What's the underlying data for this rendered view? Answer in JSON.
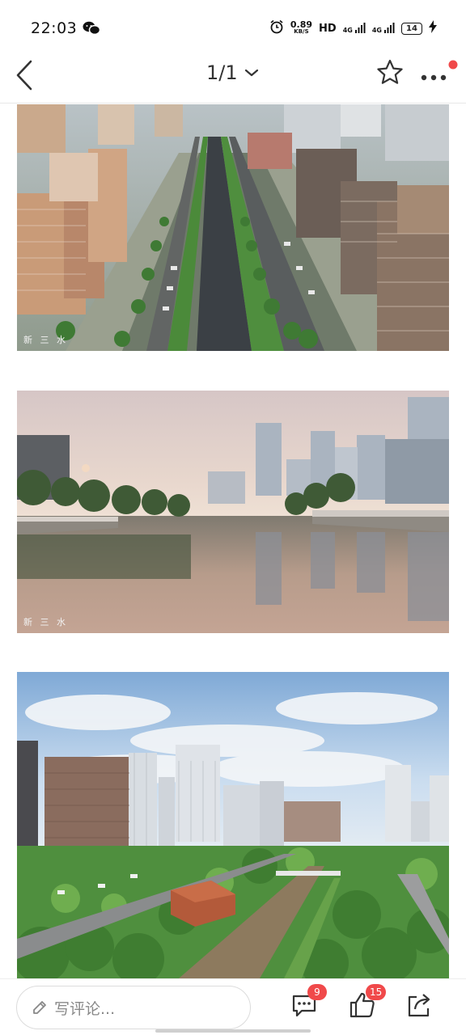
{
  "status_bar": {
    "time": "22:03",
    "net_speed_value": "0.89",
    "net_speed_unit": "KB/S",
    "hd_label": "HD",
    "network_1": "4G",
    "network_2": "4G",
    "battery": "14",
    "icons": [
      "wechat-icon",
      "alarm-icon",
      "signal-icon",
      "battery-icon",
      "charging-icon"
    ]
  },
  "nav": {
    "pager": "1/1",
    "icons": [
      "back-icon",
      "chevron-down-icon",
      "star-icon",
      "more-icon"
    ],
    "accent_color": "#f0494a"
  },
  "photos": [
    {
      "watermark": "新 三 水"
    },
    {
      "watermark": "新 三 水"
    },
    {
      "watermark": ""
    }
  ],
  "bottom_bar": {
    "comment_placeholder": "写评论...",
    "comments_count": "9",
    "likes_count": "15",
    "icons": [
      "pencil-icon",
      "comment-icon",
      "thumbs-up-icon",
      "share-icon"
    ]
  }
}
